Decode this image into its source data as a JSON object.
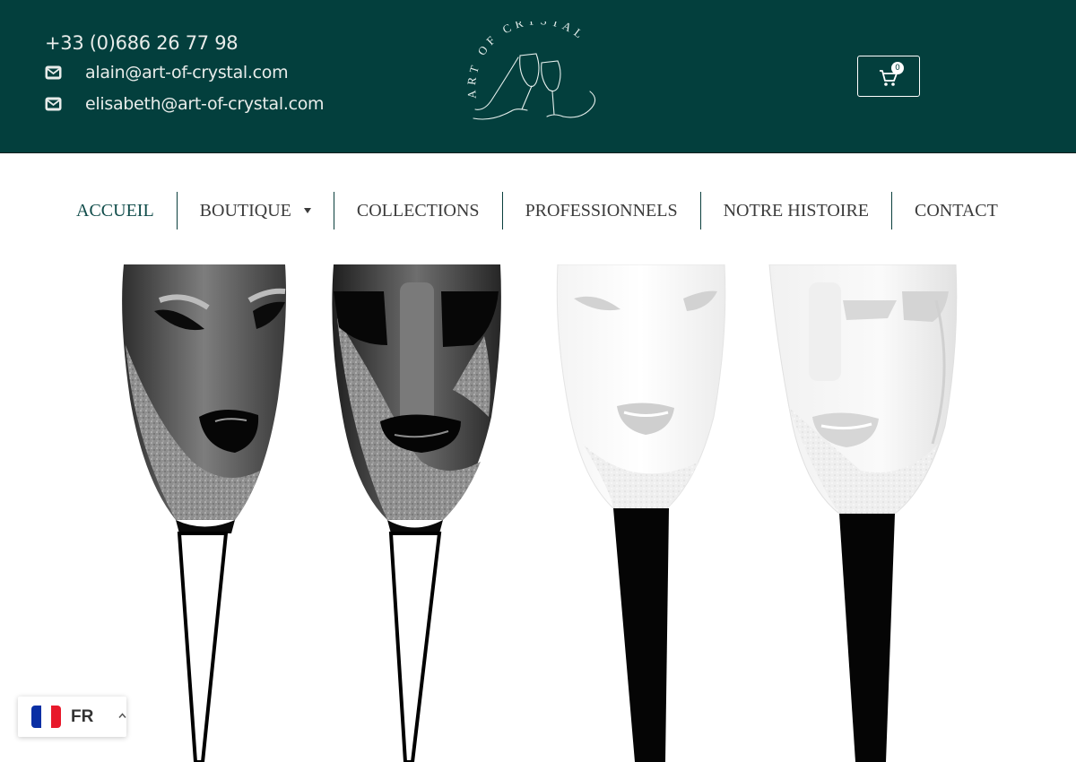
{
  "header": {
    "phone": "+33 (0)686 26 77 98",
    "emails": [
      "alain@art-of-crystal.com",
      "elisabeth@art-of-crystal.com"
    ],
    "logo_text": "ART OF CRYSTAL",
    "cart_count": "0",
    "colors": {
      "background": "#033f3d",
      "text": "#e8ecea"
    }
  },
  "nav": {
    "items": [
      {
        "label": "ACCUEIL",
        "active": true
      },
      {
        "label": "BOUTIQUE",
        "has_dropdown": true
      },
      {
        "label": "COLLECTIONS"
      },
      {
        "label": "PROFESSIONNELS"
      },
      {
        "label": "NOTRE HISTOIRE"
      },
      {
        "label": "CONTACT"
      }
    ],
    "active_color": "#104c4a",
    "separator_color": "#0a3f3d"
  },
  "language": {
    "code": "FR",
    "flag": "france-flag"
  },
  "icons": {
    "mail": "envelope-icon",
    "cart": "shopping-cart-icon",
    "caret": "caret-down-icon",
    "chevron": "chevron-up-icon"
  }
}
